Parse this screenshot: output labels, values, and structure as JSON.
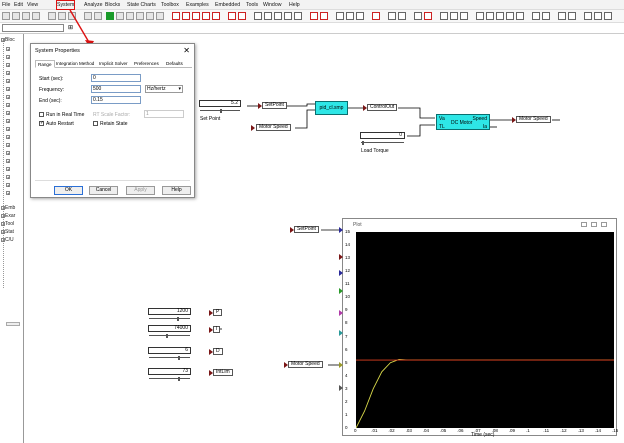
{
  "menu": [
    "File",
    "Edit",
    "View",
    "System",
    "Analyze",
    "Blocks",
    "State Charts",
    "Toolbox",
    "Examples",
    "Embedded",
    "Tools",
    "Window",
    "Help"
  ],
  "sidebar": {
    "items": [
      "Bloc",
      "",
      "",
      "",
      "",
      "",
      "",
      "",
      "",
      "",
      "",
      "",
      "",
      "",
      "",
      "",
      "",
      "",
      "",
      "",
      "",
      "",
      "",
      "",
      "",
      "Emb",
      "Exar",
      "Tool",
      "Stat",
      "C/U"
    ]
  },
  "dialog": {
    "title": "System Properties",
    "close": "✕",
    "tabs": [
      "Range",
      "Integration Method",
      "Implicit Solver",
      "Preferences",
      "Defaults"
    ],
    "start_label": "Start (sec):",
    "start_value": "0",
    "frequency_label": "Frequency:",
    "frequency_value": "500",
    "frequency_unit": "Hz/hertz",
    "end_label": "End (sec):",
    "end_value": "0.15",
    "run_realtime": "Run in Real Time",
    "rt_scale": "RT Scale Factor:",
    "rt_scale_value": "1",
    "auto_restart": "Auto Restart",
    "retain_state": "Retain State",
    "buttons": {
      "ok": "OK",
      "cancel": "Cancel",
      "apply": "Apply",
      "help": "Help"
    }
  },
  "diagram": {
    "setpoint_value": "5.2",
    "setpoint_label": "SetPoint",
    "setpoint_caption": "Set Point",
    "motor_speed_in": "Motor Speed",
    "pid_block": "pid_cl.smp",
    "control_out": "ControlOut",
    "load_value": "0",
    "load_caption": "Load Torque",
    "dc_motor": "DC Motor",
    "dc_in1": "Va",
    "dc_in2": "TL",
    "dc_out1": "Speed",
    "dc_out2": "Ia",
    "motor_speed_out": "Motor Speed",
    "setpoint_plot": "SetPoint",
    "motor_speed_plot": "Motor Speed",
    "gains": [
      {
        "value": "1200",
        "label": "P"
      },
      {
        "value": "74000",
        "label": "I"
      },
      {
        "value": "6",
        "label": "D"
      },
      {
        "value": "73",
        "label": "IntLim"
      }
    ]
  },
  "plot": {
    "title": "Plot",
    "xlabel": "Time (sec)",
    "yticks": [
      "15",
      "14",
      "13",
      "12",
      "11",
      "10",
      "9",
      "8",
      "7",
      "6",
      "5",
      "4",
      "3",
      "2",
      "1",
      "0"
    ],
    "xticks": [
      "0",
      ".01",
      ".02",
      ".03",
      ".04",
      ".05",
      ".06",
      ".07",
      ".08",
      ".09",
      ".1",
      ".11",
      ".12",
      ".13",
      ".14",
      ".15"
    ]
  },
  "chart_data": {
    "type": "line",
    "xlabel": "Time (sec)",
    "ylabel": "",
    "xlim": [
      0,
      0.15
    ],
    "ylim": [
      0,
      15
    ],
    "series": [
      {
        "color": "#d9d94a",
        "x": [
          0,
          0.005,
          0.01,
          0.015,
          0.02,
          0.025,
          0.03,
          0.04,
          0.05,
          0.15
        ],
        "y": [
          0,
          1.3,
          3.0,
          4.3,
          5.0,
          5.25,
          5.2,
          5.2,
          5.2,
          5.2
        ]
      },
      {
        "color": "#e04020",
        "x": [
          0,
          0.15
        ],
        "y": [
          5.2,
          5.2
        ]
      }
    ]
  }
}
